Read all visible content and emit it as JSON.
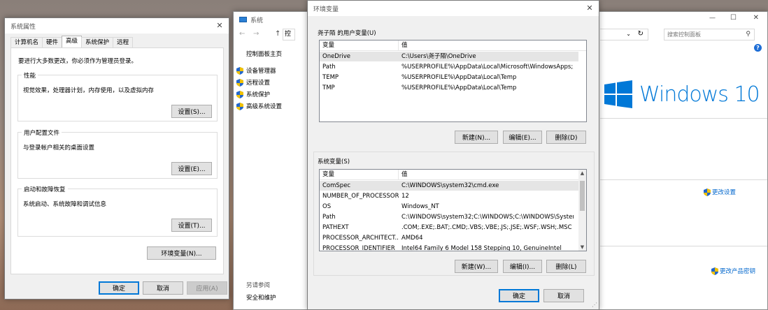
{
  "sysprop": {
    "title": "系统属性",
    "tabs": [
      "计算机名",
      "硬件",
      "高级",
      "系统保护",
      "远程"
    ],
    "admin_note": "要进行大多数更改，你必须作为管理员登录。",
    "perf": {
      "title": "性能",
      "desc": "视觉效果，处理器计划，内存使用，以及虚拟内存",
      "button": "设置(S)..."
    },
    "profile": {
      "title": "用户配置文件",
      "desc": "与登录帐户相关的桌面设置",
      "button": "设置(E)..."
    },
    "startup": {
      "title": "启动和故障恢复",
      "desc": "系统启动、系统故障和调试信息",
      "button": "设置(T)..."
    },
    "env_button": "环境变量(N)...",
    "ok": "确定",
    "cancel": "取消",
    "apply": "应用(A)"
  },
  "system": {
    "title": "系统",
    "crumb": "控",
    "nav_back": "←",
    "nav_forward": "→",
    "nav_up": "↑",
    "sidebar_home": "控制面板主页",
    "sidebar_items": [
      "设备管理器",
      "远程设置",
      "系统保护",
      "高级系统设置"
    ],
    "see_also": "另请参阅",
    "security": "安全和维护",
    "search_placeholder": "搜索控制面板",
    "logo_text": "Windows 10",
    "change_settings": "更改设置",
    "change_key": "更改产品密钥",
    "help": "?",
    "window_controls": {
      "minimize": "—",
      "maximize": "☐",
      "close": "✕"
    }
  },
  "env": {
    "title": "环境变量",
    "user_label": "尧子陌 的用户变量(U)",
    "col_var": "变量",
    "col_val": "值",
    "user_vars": [
      {
        "name": "OneDrive",
        "value": "C:\\Users\\尧子陌\\OneDrive"
      },
      {
        "name": "Path",
        "value": "%USERPROFILE%\\AppData\\Local\\Microsoft\\WindowsApps;;E:..."
      },
      {
        "name": "TEMP",
        "value": "%USERPROFILE%\\AppData\\Local\\Temp"
      },
      {
        "name": "TMP",
        "value": "%USERPROFILE%\\AppData\\Local\\Temp"
      }
    ],
    "user_buttons": [
      "新建(N)...",
      "编辑(E)...",
      "删除(D)"
    ],
    "sys_label": "系统变量(S)",
    "sys_vars": [
      {
        "name": "ComSpec",
        "value": "C:\\WINDOWS\\system32\\cmd.exe"
      },
      {
        "name": "NUMBER_OF_PROCESSORS",
        "value": "12"
      },
      {
        "name": "OS",
        "value": "Windows_NT"
      },
      {
        "name": "Path",
        "value": "C:\\WINDOWS\\system32;C:\\WINDOWS;C:\\WINDOWS\\System..."
      },
      {
        "name": "PATHEXT",
        "value": ".COM;.EXE;.BAT;.CMD;.VBS;.VBE;.JS;.JSE;.WSF;.WSH;.MSC"
      },
      {
        "name": "PROCESSOR_ARCHITECT...",
        "value": "AMD64"
      },
      {
        "name": "PROCESSOR_IDENTIFIER",
        "value": "Intel64 Family 6 Model 158 Stepping 10, GenuineIntel"
      }
    ],
    "sys_buttons": [
      "新建(W)...",
      "编辑(I)...",
      "删除(L)"
    ],
    "ok": "确定",
    "cancel": "取消"
  },
  "colors": {
    "accent": "#0078d7",
    "link": "#0066cc"
  }
}
